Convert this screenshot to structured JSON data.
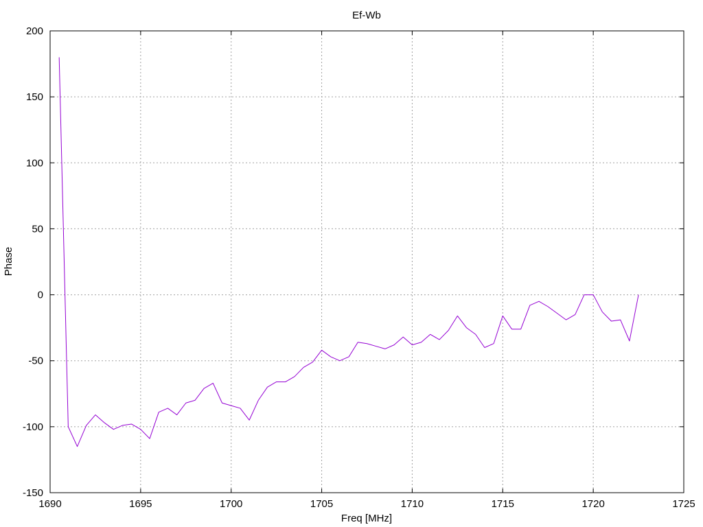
{
  "chart_data": {
    "type": "line",
    "title": "Ef-Wb",
    "xlabel": "Freq [MHz]",
    "ylabel": "Phase",
    "xlim": [
      1690,
      1725
    ],
    "ylim": [
      -150,
      200
    ],
    "xticks": [
      1690,
      1695,
      1700,
      1705,
      1710,
      1715,
      1720,
      1725
    ],
    "yticks": [
      -150,
      -100,
      -50,
      0,
      50,
      100,
      150,
      200
    ],
    "grid": true,
    "line_color": "#9400D3",
    "series": [
      {
        "x": [
          1690.5,
          1691.0,
          1691.5,
          1692.0,
          1692.5,
          1693.0,
          1693.5,
          1694.0,
          1694.5,
          1695.0,
          1695.5,
          1696.0,
          1696.5,
          1697.0,
          1697.5,
          1698.0,
          1698.5,
          1699.0,
          1699.5,
          1700.0,
          1700.5,
          1701.0,
          1701.5,
          1702.0,
          1702.5,
          1703.0,
          1703.5,
          1704.0,
          1704.5,
          1705.0,
          1705.5,
          1706.0,
          1706.5,
          1707.0,
          1707.5,
          1708.0,
          1708.5,
          1709.0,
          1709.5,
          1710.0,
          1710.5,
          1711.0,
          1711.5,
          1712.0,
          1712.5,
          1713.0,
          1713.5,
          1714.0,
          1714.5,
          1715.0,
          1715.5,
          1716.0,
          1716.5,
          1717.0,
          1717.5,
          1718.0,
          1718.5,
          1719.0,
          1719.5,
          1720.0,
          1720.5,
          1721.0,
          1721.5,
          1722.0,
          1722.5
        ],
        "y": [
          180,
          -100,
          -115,
          -99,
          -91,
          -97,
          -102,
          -99,
          -98,
          -102,
          -109,
          -89,
          -86,
          -91,
          -82,
          -80,
          -71,
          -67,
          -82,
          -84,
          -86,
          -95,
          -80,
          -70,
          -66,
          -66,
          -62,
          -55,
          -51,
          -42,
          -47,
          -50,
          -47,
          -36,
          -37,
          -39,
          -41,
          -38,
          -32,
          -38,
          -36,
          -30,
          -34,
          -27,
          -16,
          -25,
          -30,
          -40,
          -37,
          -16,
          -26,
          -26,
          -8,
          -5,
          -9,
          -14,
          -19,
          -15,
          0,
          0,
          -13,
          -20,
          -19,
          -35,
          0
        ]
      }
    ]
  }
}
